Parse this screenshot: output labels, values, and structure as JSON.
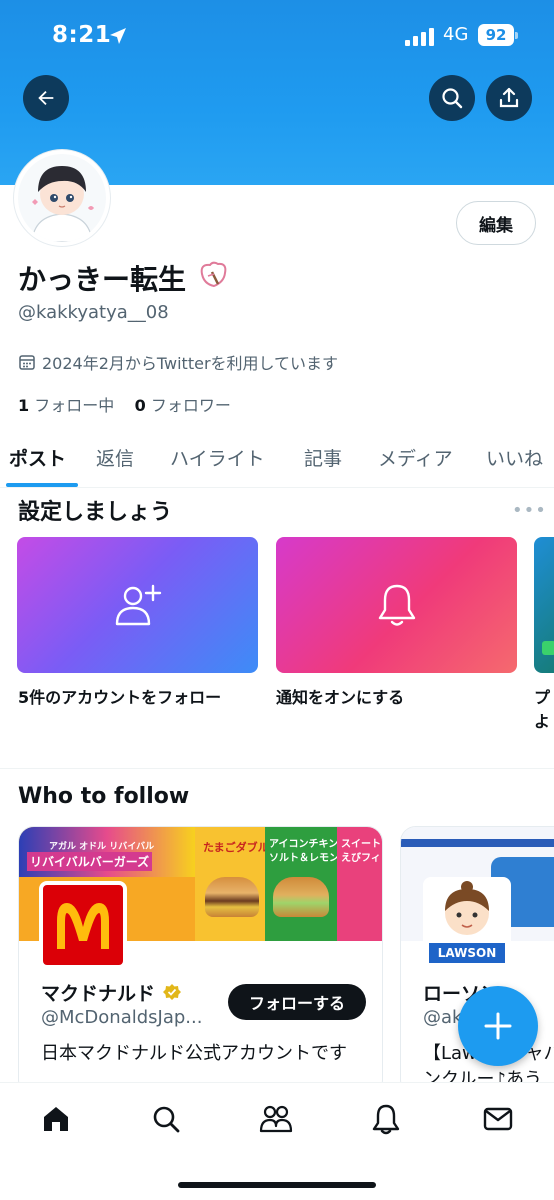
{
  "status_bar": {
    "time": "8:21",
    "network": "4G",
    "battery": "92"
  },
  "header": {
    "back_icon": "arrow-left-icon",
    "search_icon": "search-icon",
    "share_icon": "share-icon"
  },
  "profile": {
    "display_name": "かっきー転生",
    "handle": "@kakkyatya__08",
    "joined": "2024年2月からTwitterを利用しています",
    "following_count": "1",
    "following_label": "フォロー中",
    "followers_count": "0",
    "followers_label": "フォロワー",
    "edit_label": "編集"
  },
  "tabs": [
    "ポスト",
    "返信",
    "ハイライト",
    "記事",
    "メディア",
    "いいね"
  ],
  "setup": {
    "title": "設定しましょう",
    "cards": [
      {
        "label": "5件のアカウントをフォロー",
        "icon": "add-user-icon"
      },
      {
        "label": "通知をオンにする",
        "icon": "bell-icon"
      },
      {
        "label": "プ",
        "sub": "よ"
      }
    ]
  },
  "who_to_follow": {
    "title": "Who to follow",
    "accounts": [
      {
        "name": "マクドナルド",
        "handle": "@McDonaldsJap...",
        "bio": "日本マクドナルド公式アカウントです",
        "follow_label": "フォローする",
        "banner_texts": [
          "アガル オドル リバイバル",
          "リバイバルバーガーズ",
          "たまごダブル",
          "アイコンチキン",
          "ソルト＆レモン",
          "スイート",
          "えびフィ"
        ]
      },
      {
        "name": "ローソン",
        "handle": "@akiso...",
        "bio": "【Lawsonジャパ",
        "bio2": "ンクルー♪あう",
        "logo_text": "LAWSON"
      }
    ]
  },
  "colors": {
    "accent": "#1d9bf0",
    "banner": "#1f9bf0",
    "text": "#0f1419",
    "muted": "#536471"
  }
}
